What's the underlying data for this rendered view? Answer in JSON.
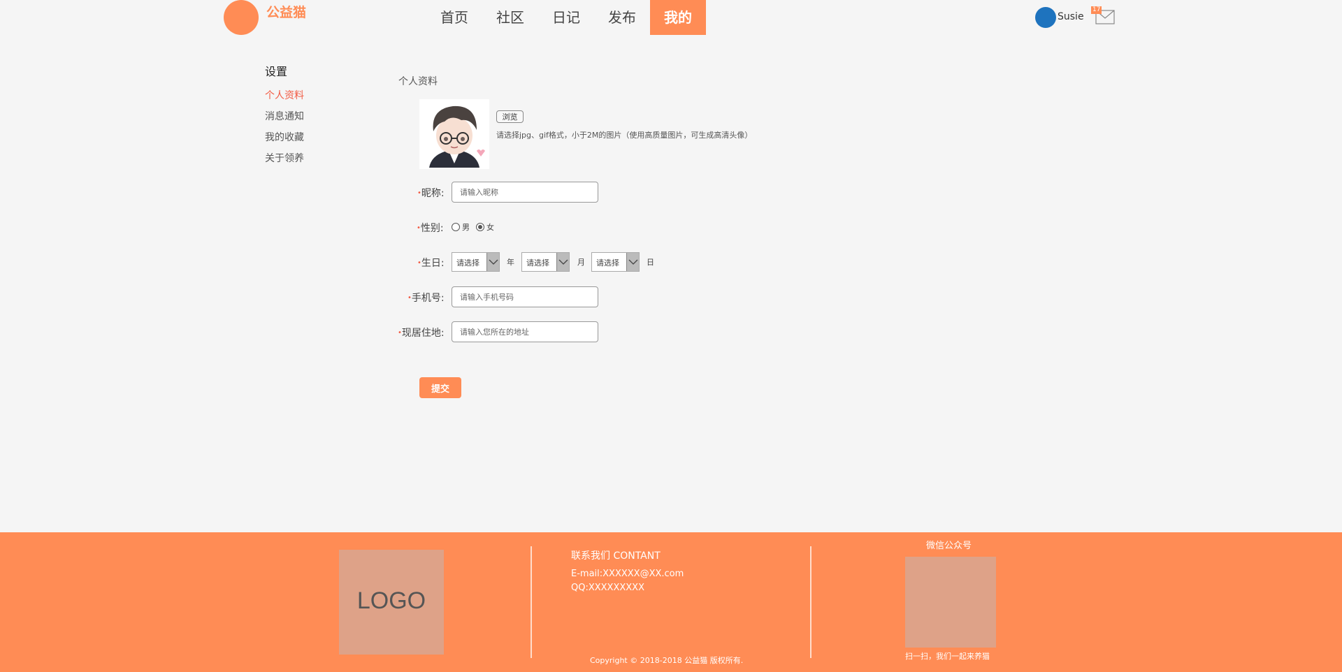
{
  "header": {
    "brand": "公益猫",
    "nav": [
      "首页",
      "社区",
      "日记",
      "发布",
      "我的"
    ],
    "active_nav": "我的",
    "user": {
      "name": "Susie",
      "mail_count": "17"
    }
  },
  "sidebar": {
    "title": "设置",
    "items": [
      "个人资料",
      "消息通知",
      "我的收藏",
      "关于领养"
    ],
    "active": "个人资料"
  },
  "profile": {
    "section_title": "个人资料",
    "browse_label": "浏览",
    "avatar_hint": "请选择jpg、gif格式，小于2M的图片（使用高质量图片，可生成高清头像）",
    "nickname": {
      "label": "昵称:",
      "placeholder": "请输入昵称"
    },
    "gender": {
      "label": "性别:",
      "options": [
        "男",
        "女"
      ],
      "selected": "女"
    },
    "birthday": {
      "label": "生日:",
      "year": {
        "value": "请选择",
        "unit": "年"
      },
      "month": {
        "value": "请选择",
        "unit": "月"
      },
      "day": {
        "value": "请选择",
        "unit": "日"
      }
    },
    "phone": {
      "label": "手机号:",
      "placeholder": "请输入手机号码"
    },
    "address": {
      "label": "现居住地:",
      "placeholder": "请输入您所在的地址"
    },
    "submit_label": "提交"
  },
  "footer": {
    "logo_text": "LOGO",
    "contact_title": "联系我们 CONTANT",
    "email": "E-mail:XXXXXX@XX.com",
    "qq": "QQ:XXXXXXXXX",
    "copyright": "Copyright © 2018-2018 公益猫 版权所有.",
    "wechat_title": "微信公众号",
    "qr_caption": "扫一扫，我们一起来养猫"
  },
  "colors": {
    "accent": "#ff8c55",
    "active_text": "#f25b44",
    "avatar_blue": "#1e73be",
    "footer_placeholder": "#dea288"
  }
}
